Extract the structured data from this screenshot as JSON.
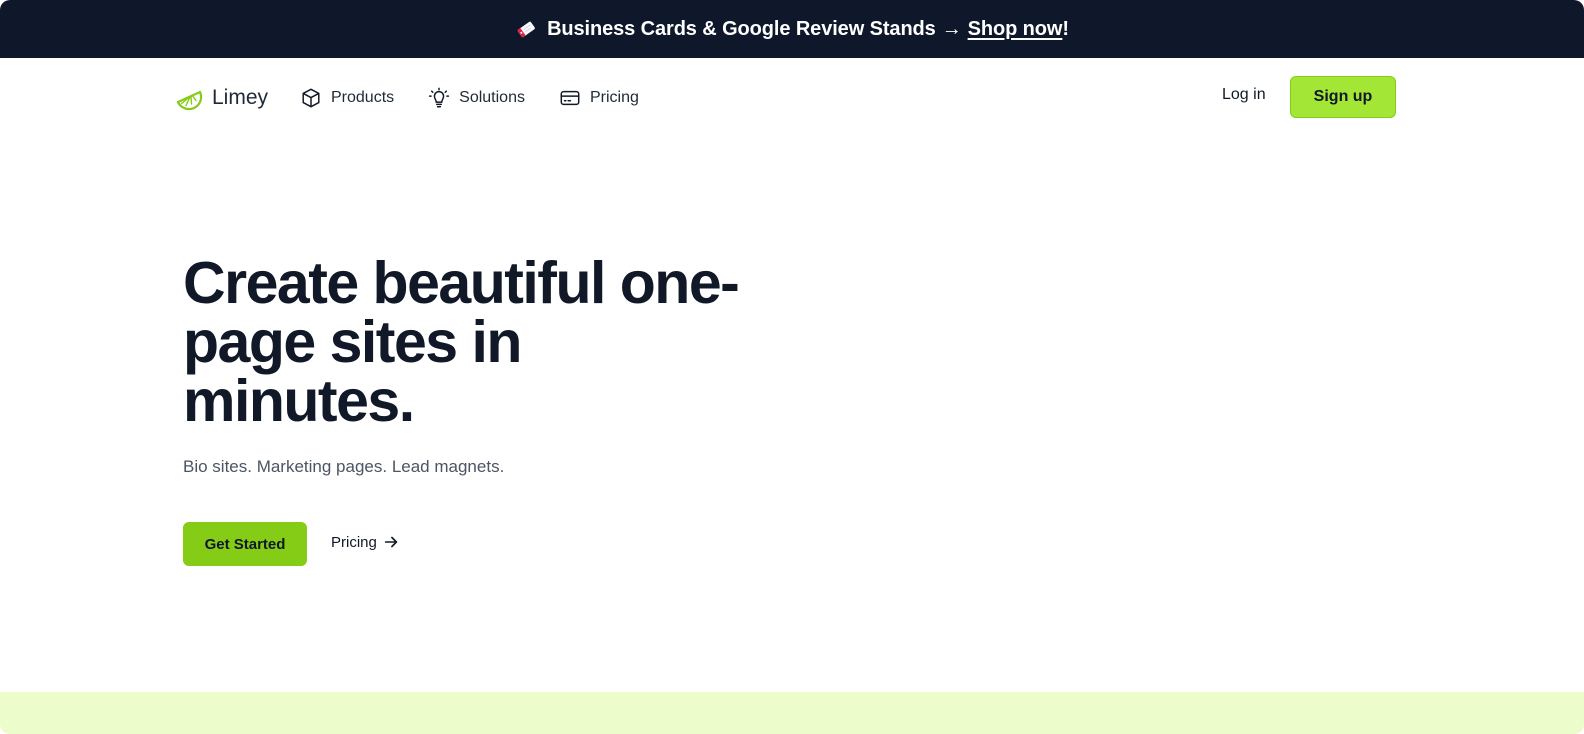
{
  "announcement": {
    "icon": "price-tag-icon",
    "text": "Business Cards & Google Review Stands",
    "arrow": "→",
    "link_text": "Shop now",
    "suffix": "!"
  },
  "nav": {
    "logo_text": "Limey",
    "logo_icon": "lime-slice-icon",
    "links": [
      {
        "label": "Products",
        "icon": "box-icon"
      },
      {
        "label": "Solutions",
        "icon": "lightbulb-icon"
      },
      {
        "label": "Pricing",
        "icon": "credit-card-icon"
      }
    ],
    "login_label": "Log in",
    "signup_label": "Sign up"
  },
  "hero": {
    "title_lines": [
      "Create beautiful one-",
      "page sites in",
      "minutes."
    ],
    "subtitle": "Bio sites. Marketing pages. Lead magnets.",
    "cta_primary": "Get Started",
    "cta_secondary": "Pricing"
  },
  "colors": {
    "announcement_bg": "#0f172a",
    "accent": "#84cc16",
    "signup_bg": "#a3e635",
    "bottom_band": "#ecfccb",
    "heading": "#111827",
    "muted": "#4b5563"
  }
}
